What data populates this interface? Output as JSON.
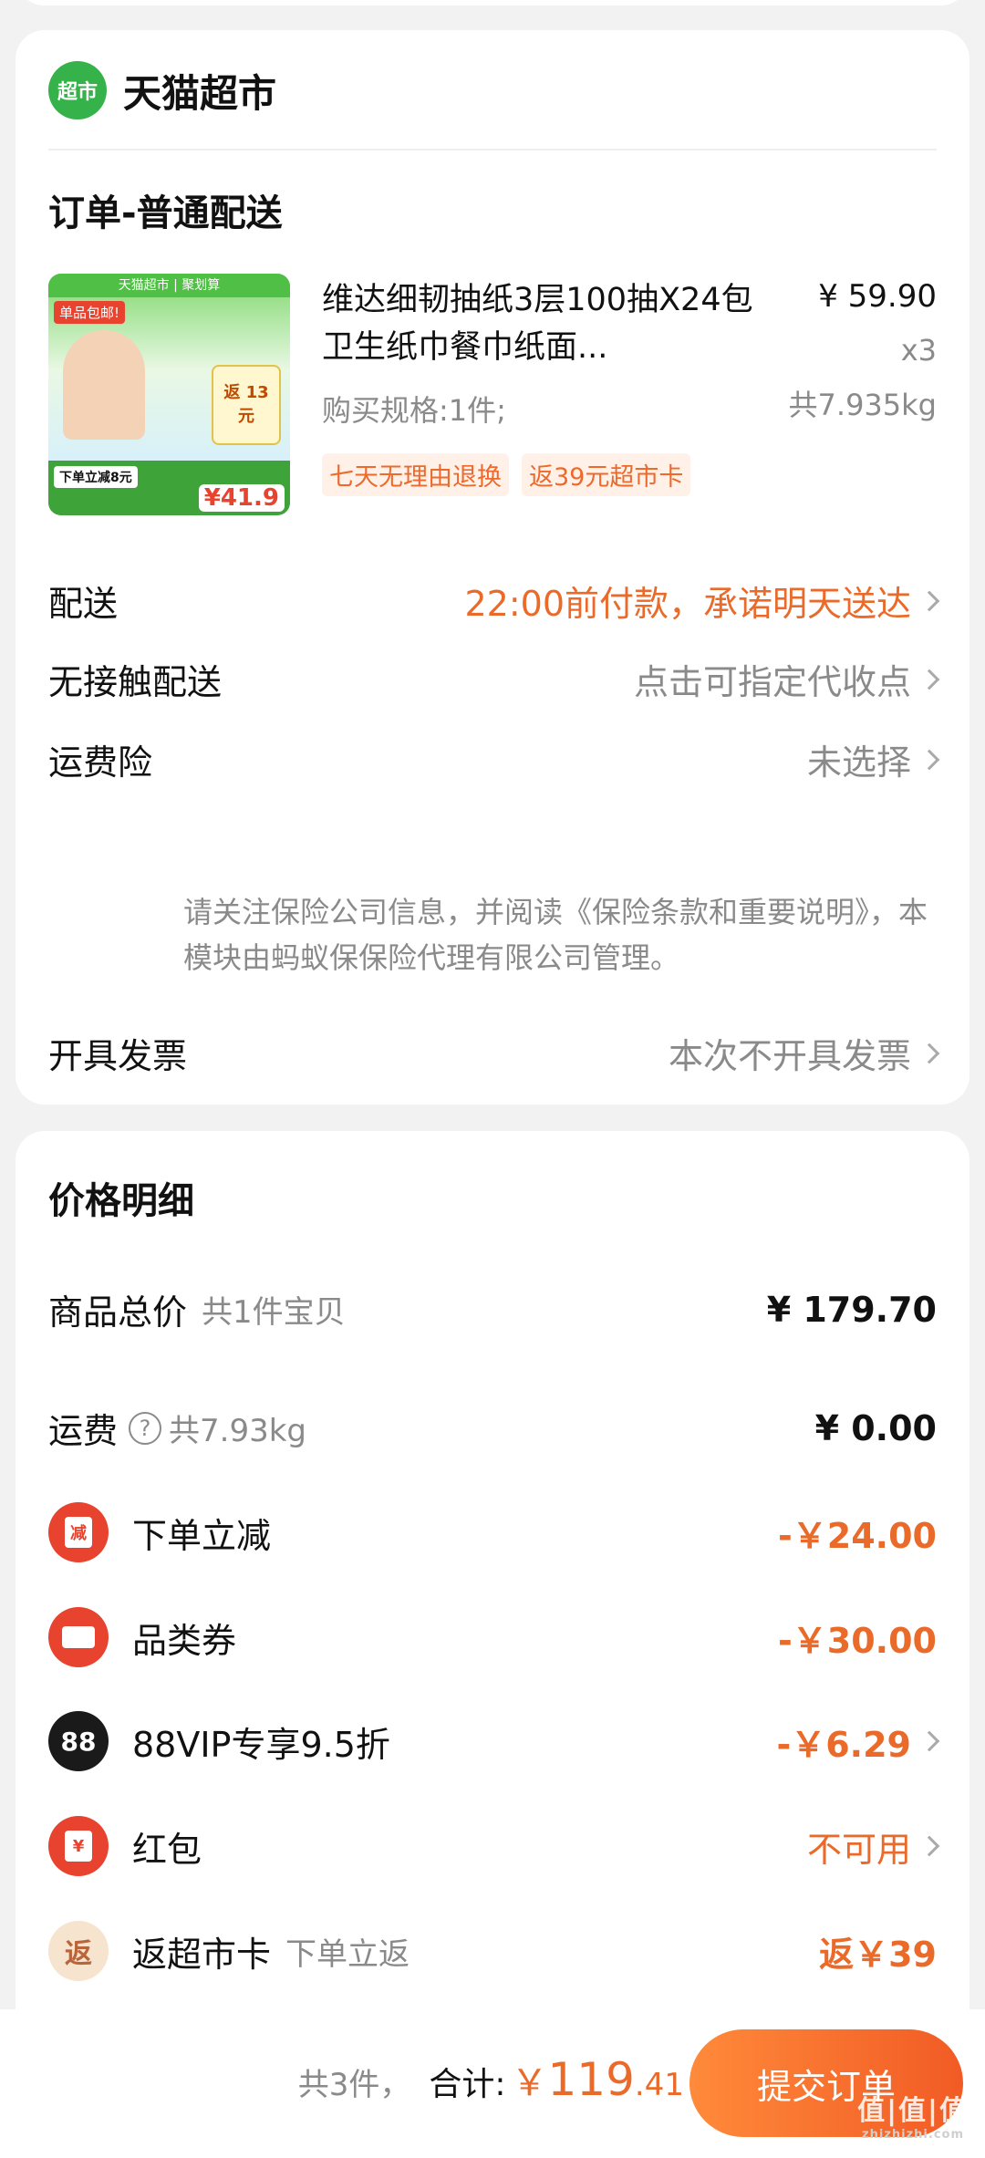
{
  "shop": {
    "logo_text": "超市",
    "name": "天猫超市"
  },
  "order_type": "订单-普通配送",
  "product": {
    "image_texts": {
      "top": "天猫超市 | 聚划算",
      "badge": "单品包邮!",
      "tag": "返 13 元",
      "promo": "下单立减8元",
      "price": "¥41.9"
    },
    "title": "维达细韧抽纸3层100抽X24包卫生纸巾餐巾纸面...",
    "spec": "购买规格:1件;",
    "price": "¥ 59.90",
    "qty": "x3",
    "weight": "共7.935kg",
    "tags": [
      "七天无理由退换",
      "返39元超市卡"
    ]
  },
  "rows": {
    "delivery": {
      "label": "配送",
      "value": "22:00前付款，承诺明天送达"
    },
    "contactless": {
      "label": "无接触配送",
      "value": "点击可指定代收点"
    },
    "insurance": {
      "label": "运费险",
      "value": "未选择",
      "note": "请关注保险公司信息，并阅读《保险条款和重要说明》，本模块由蚂蚁保保险代理有限公司管理。"
    },
    "invoice": {
      "label": "开具发票",
      "value": "本次不开具发票"
    }
  },
  "price_detail": {
    "title": "价格明细",
    "subtotal": {
      "label": "商品总价",
      "sub": "共1件宝贝",
      "amount": "¥ 179.70"
    },
    "shipping": {
      "label": "运费",
      "help": "?",
      "sub": "共7.93kg",
      "amount": "¥ 0.00"
    },
    "instant_discount": {
      "label": "下单立减",
      "icon_text": "减",
      "amount": "-￥24.00"
    },
    "category_coupon": {
      "label": "品类券",
      "amount": "-￥30.00"
    },
    "vip": {
      "label": "88VIP专享9.5折",
      "icon_text": "88",
      "amount": "-￥6.29"
    },
    "red_packet": {
      "label": "红包",
      "icon_text": "¥",
      "amount": "不可用"
    },
    "market_card": {
      "label": "返超市卡",
      "icon_text": "返",
      "sub": "下单立返",
      "amount": "返￥39"
    }
  },
  "bottom": {
    "count": "共3件，",
    "total_label": "合计:",
    "currency": "￥",
    "total_int": "119",
    "total_dec": ".41",
    "submit": "提交订单",
    "watermark": "值|值|值",
    "watermark_sub": "zhizhizhi.com"
  },
  "colors": {
    "accent": "#ea6a2a",
    "brand_green": "#36b24a",
    "discount_red": "#e8432e"
  }
}
